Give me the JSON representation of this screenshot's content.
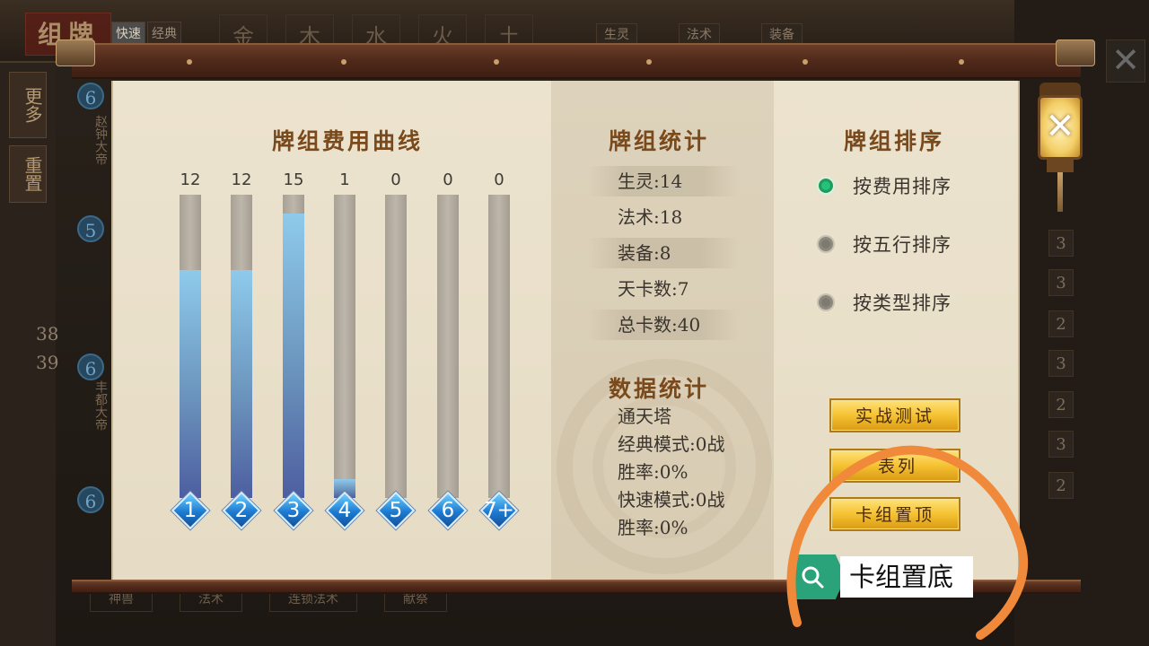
{
  "background": {
    "title": "组牌",
    "mode_toggle": [
      "快速",
      "经典"
    ],
    "elements": [
      "金",
      "木",
      "水",
      "火",
      "土"
    ],
    "filters": [
      "生灵",
      "法术",
      "装备"
    ],
    "side_buttons": [
      "更多",
      "重置"
    ],
    "deck_counts": [
      "38",
      "39"
    ],
    "card_costs": [
      "6",
      "5",
      "6",
      "6"
    ],
    "card_names": [
      "赵钟大帝",
      "丰都大帝"
    ],
    "right_counts": [
      "3",
      "3",
      "2",
      "3",
      "2",
      "3",
      "2"
    ],
    "bottom_cards": [
      "神兽",
      "法术",
      "连锁法术",
      "献祭"
    ]
  },
  "cost_curve": {
    "heading": "牌组费用曲线",
    "bars": [
      {
        "label": "1",
        "count": 12
      },
      {
        "label": "2",
        "count": 12
      },
      {
        "label": "3",
        "count": 15
      },
      {
        "label": "4",
        "count": 1
      },
      {
        "label": "5",
        "count": 0
      },
      {
        "label": "6",
        "count": 0
      },
      {
        "label": "7+",
        "count": 0
      }
    ],
    "max": 16
  },
  "deck_stats": {
    "heading": "牌组统计",
    "rows": [
      "生灵:14",
      "法术:18",
      "装备:8",
      "天卡数:7",
      "总卡数:40"
    ]
  },
  "data_stats": {
    "heading": "数据统计",
    "lines": [
      "通天塔",
      "经典模式:0战",
      "胜率:0%",
      "快速模式:0战",
      "胜率:0%"
    ]
  },
  "sorting": {
    "heading": "牌组排序",
    "options": [
      {
        "label": "按费用排序",
        "selected": true
      },
      {
        "label": "按五行排序",
        "selected": false
      },
      {
        "label": "按类型排序",
        "selected": false
      }
    ]
  },
  "buttons": {
    "battle_test": "实战测试",
    "list": "表列",
    "pin_top": "卡组置顶"
  },
  "tooltip": {
    "icon": "search-icon",
    "text": "卡组置底"
  },
  "colors": {
    "accent": "#7a4a1c",
    "bar_fill": "#6b94bd",
    "selected_radio": "#27c27a",
    "annotation": "#f08a3a"
  }
}
